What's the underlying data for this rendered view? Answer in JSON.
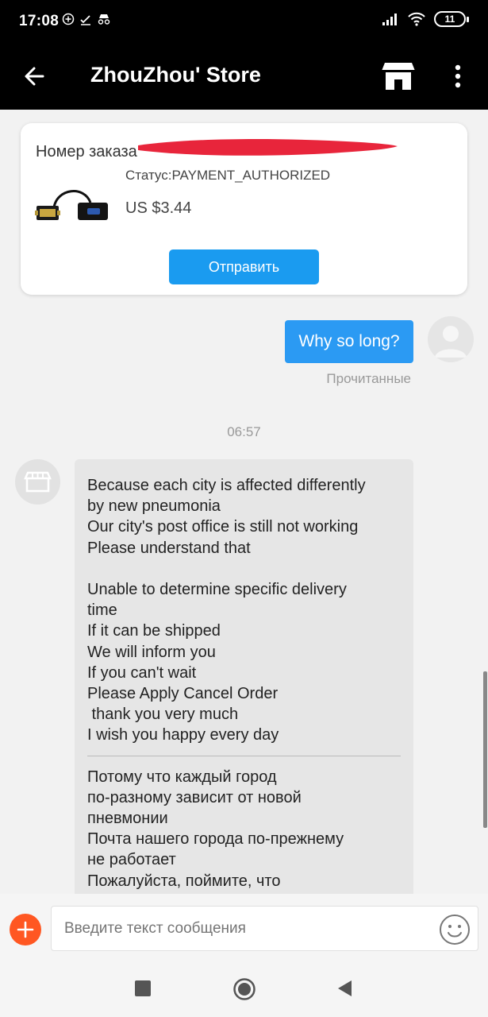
{
  "status_bar": {
    "time": "17:08",
    "battery": "11",
    "icons": [
      "plus-circle-icon",
      "download-check-icon",
      "incognito-icon",
      "signal-icon",
      "wifi-icon",
      "battery-icon"
    ]
  },
  "app_bar": {
    "title": "ZhouZhou' Store",
    "icons": [
      "back-arrow-icon",
      "store-icon",
      "more-vertical-icon"
    ]
  },
  "order_card": {
    "number_label": "Номер заказа",
    "status": "Статус:PAYMENT_AUTHORIZED",
    "price": "US $3.44",
    "send_button": "Отправить",
    "redaction_color": "#e8253b"
  },
  "messages": {
    "sent": {
      "text": "Why so long?",
      "read_status": "Прочитанные"
    },
    "timestamp": "06:57",
    "received": {
      "english_lines": [
        "Because each city is affected differently",
        "by new pneumonia",
        "Our city's post office is still not working",
        "Please understand that",
        "",
        "Unable to determine specific delivery",
        "time",
        "If it can be shipped",
        "We will inform you",
        "If you can't wait",
        "Please Apply Cancel Order",
        " thank you very much",
        "I wish you happy every day"
      ],
      "russian_lines": [
        "Потому что каждый город",
        "по-разному зависит от новой",
        "пневмонии",
        "Почта нашего города по-прежнему",
        "не работает",
        "Пожалуйста, поймите, что"
      ]
    }
  },
  "input_bar": {
    "placeholder": "Введите текст сообщения"
  },
  "colors": {
    "accent_blue": "#2b9af3",
    "send_button_blue": "#1a9bf0",
    "add_button_orange": "#ff5722",
    "header_black": "#000000"
  }
}
